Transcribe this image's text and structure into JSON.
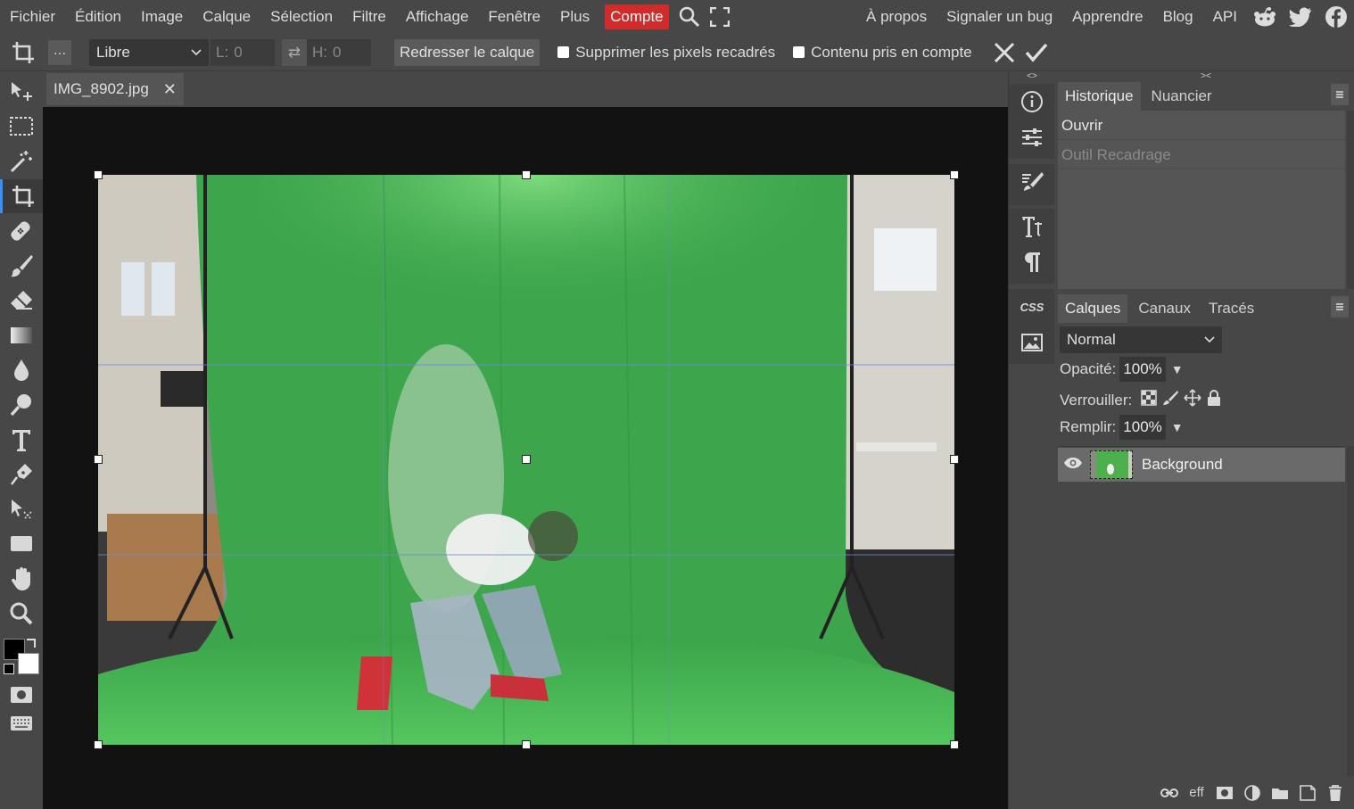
{
  "menu": {
    "items": [
      "Fichier",
      "Édition",
      "Image",
      "Calque",
      "Sélection",
      "Filtre",
      "Affichage",
      "Fenêtre",
      "Plus"
    ],
    "account": "Compte",
    "right_links": [
      "À propos",
      "Signaler un bug",
      "Apprendre",
      "Blog",
      "API"
    ],
    "accent_color": "#d22b2b"
  },
  "options": {
    "dots": "...",
    "ratio": "Libre",
    "width_label": "L:",
    "width_value": "0",
    "height_label": "H:",
    "height_value": "0",
    "straighten": "Redresser le calque",
    "delete_pixels": "Supprimer les pixels recadrés",
    "content_aware": "Contenu pris en compte"
  },
  "document": {
    "tab_name": "IMG_8902.jpg"
  },
  "history_panel": {
    "tabs": [
      "Historique",
      "Nuancier"
    ],
    "entries": [
      "Ouvrir",
      "Outil Recadrage"
    ]
  },
  "layers_panel": {
    "tabs": [
      "Calques",
      "Canaux",
      "Tracés"
    ],
    "blend_mode": "Normal",
    "opacity_label": "Opacité:",
    "opacity_value": "100%",
    "lock_label": "Verrouiller:",
    "fill_label": "Remplir:",
    "fill_value": "100%",
    "layers": [
      {
        "name": "Background"
      }
    ],
    "footer_eff": "eff"
  },
  "iconcol": {
    "css_label": "CSS"
  },
  "colors": {
    "foreground": "#000000",
    "background": "#ffffff",
    "active_tool": "#3c8ff0"
  }
}
